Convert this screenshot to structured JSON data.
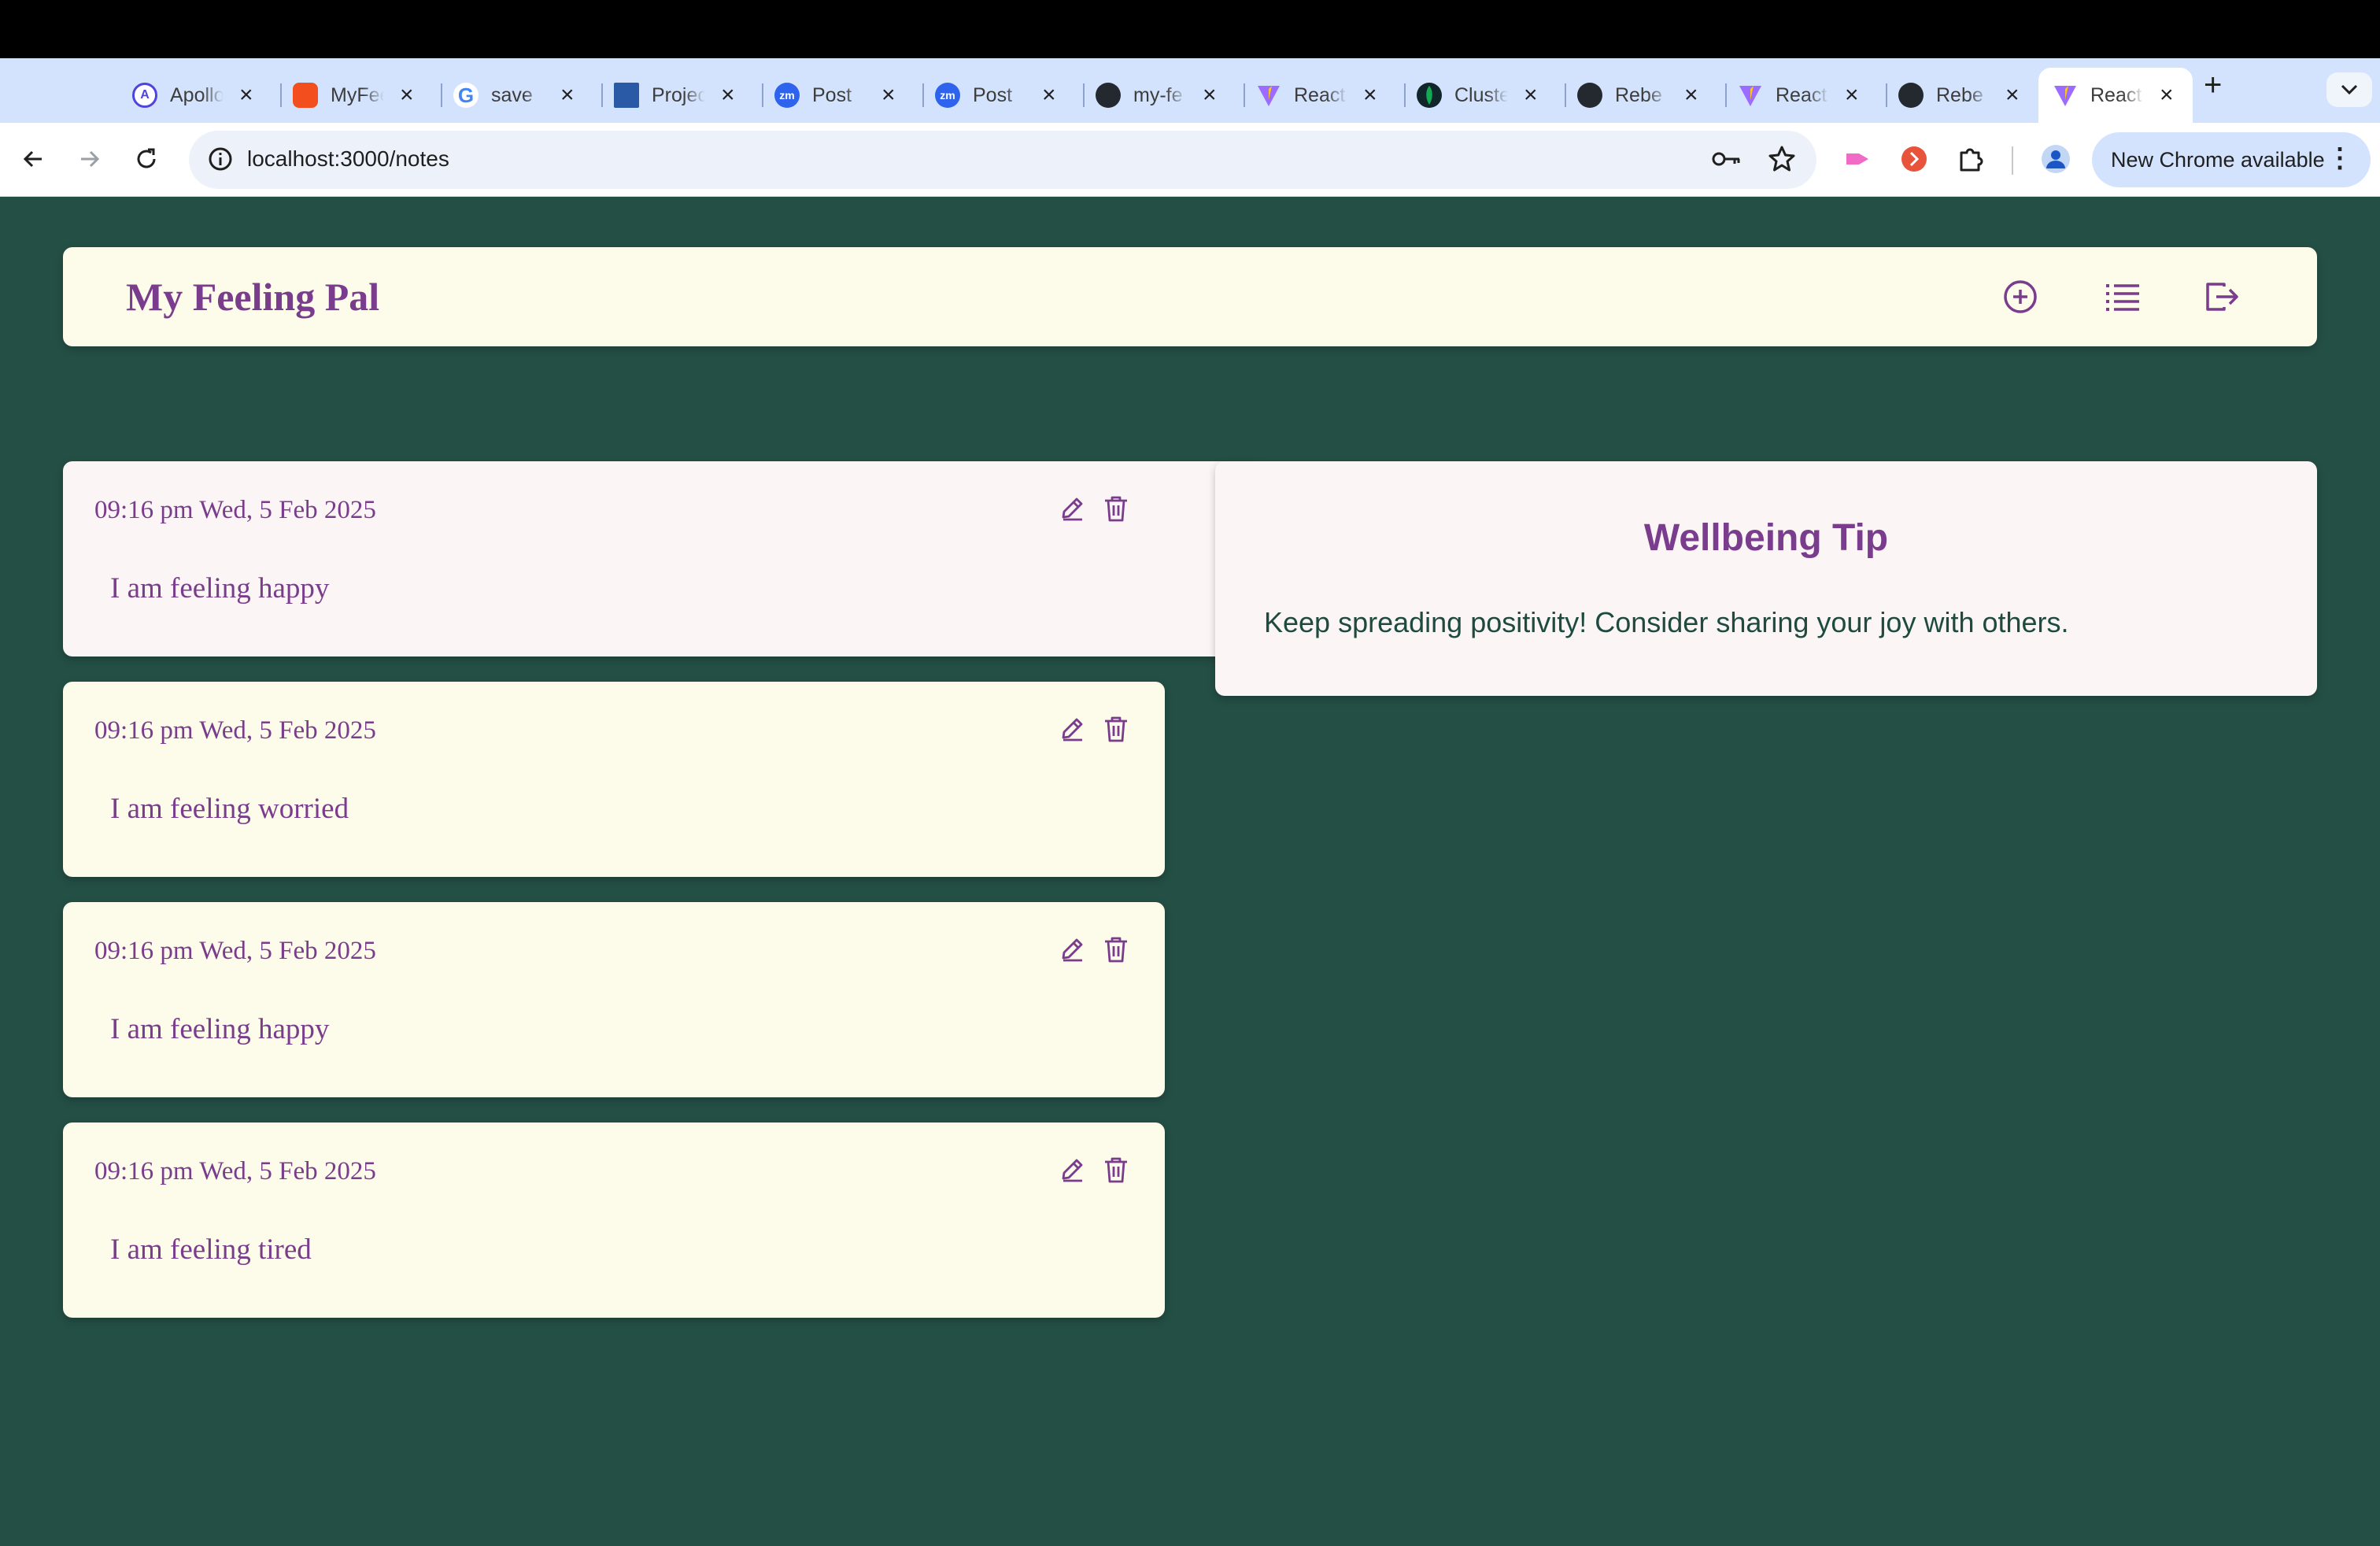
{
  "browser": {
    "tabs": [
      {
        "label": "Apollo",
        "favicon": "apollo-icon",
        "color": "#4f44e0"
      },
      {
        "label": "MyFeeling",
        "favicon": "figma-icon",
        "color": "#f24e1e"
      },
      {
        "label": "save",
        "favicon": "google-icon",
        "color": "#4285f4"
      },
      {
        "label": "Project",
        "favicon": "project-board-icon",
        "color": "#2a5aa5"
      },
      {
        "label": "Post",
        "favicon": "zoom-icon",
        "color": "#2d63ed"
      },
      {
        "label": "Post",
        "favicon": "zoom-icon",
        "color": "#2d63ed"
      },
      {
        "label": "my-fe",
        "favicon": "github-actions-icon",
        "color": "#24292f"
      },
      {
        "label": "React",
        "favicon": "vite-icon",
        "color": "#9b6cff"
      },
      {
        "label": "Cluster",
        "favicon": "mongodb-icon",
        "color": "#13aa52"
      },
      {
        "label": "Rebe",
        "favicon": "github-icon",
        "color": "#24292f"
      },
      {
        "label": "React",
        "favicon": "vite-icon",
        "color": "#9b6cff"
      },
      {
        "label": "Rebe",
        "favicon": "github-icon",
        "color": "#24292f"
      },
      {
        "label": "React",
        "favicon": "vite-icon",
        "color": "#9b6cff",
        "active": true
      }
    ],
    "new_tab": "+",
    "url": "localhost:3000/notes",
    "update_button": "New Chrome available"
  },
  "app": {
    "title": "My Feeling Pal",
    "header_icons": [
      "add-note-icon",
      "list-icon",
      "logout-icon"
    ]
  },
  "notes": [
    {
      "date": "09:16 pm Wed, 5 Feb 2025",
      "text": "I am feeling happy"
    },
    {
      "date": "09:16 pm Wed, 5 Feb 2025",
      "text": "I am feeling worried"
    },
    {
      "date": "09:16 pm Wed, 5 Feb 2025",
      "text": "I am feeling happy"
    },
    {
      "date": "09:16 pm Wed, 5 Feb 2025",
      "text": "I am feeling tired"
    }
  ],
  "tip": {
    "title": "Wellbeing Tip",
    "text": "Keep spreading positivity! Consider sharing your joy with others."
  },
  "colors": {
    "page_bg": "#244f45",
    "card_bg": "#fdfbea",
    "accent": "#7a3c8c"
  }
}
